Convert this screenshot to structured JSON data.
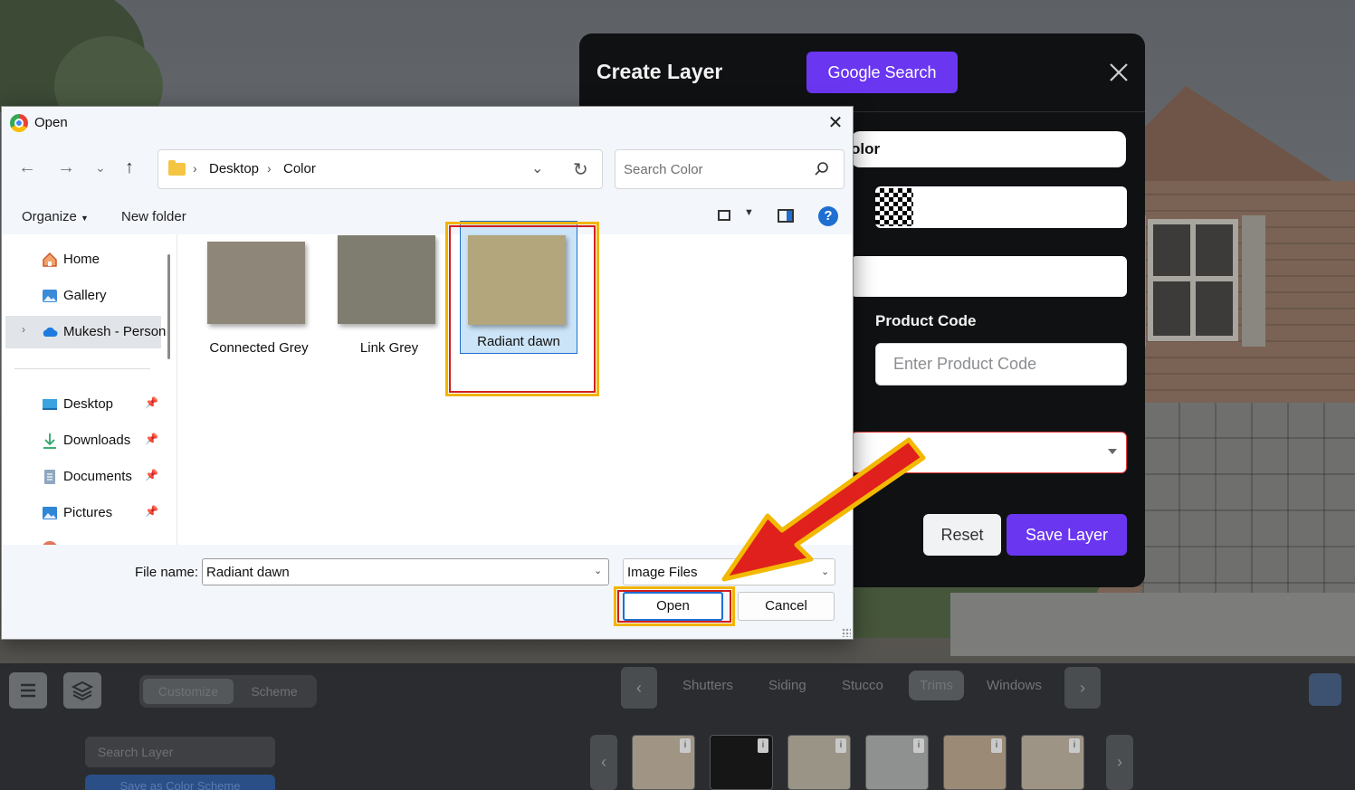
{
  "background_app": {
    "toolbar": {
      "mode_tabs": [
        "Customize",
        "Scheme"
      ],
      "categories": [
        "Shutters",
        "Siding",
        "Stucco",
        "Trims",
        "Windows"
      ],
      "active_category": "Trims",
      "search_layer_placeholder": "Search Layer",
      "save_scheme_label": "Save as Color Scheme",
      "swatches": [
        {
          "color": "#a09585"
        },
        {
          "color": "#161616"
        },
        {
          "color": "#9a9487"
        },
        {
          "color": "#8f9190"
        },
        {
          "color": "#9a8a76"
        },
        {
          "color": "#9e9486"
        }
      ]
    }
  },
  "modal": {
    "title": "Create Layer",
    "google_search_label": "Google Search",
    "name_field_value": "olor",
    "product_code_label": "Product Code",
    "product_code_placeholder": "Enter Product Code",
    "reset_label": "Reset",
    "save_label": "Save Layer",
    "accent_color": "#6a36f0"
  },
  "dialog": {
    "title": "Open",
    "breadcrumb": [
      "Desktop",
      "Color"
    ],
    "search_placeholder": "Search Color",
    "organize_label": "Organize",
    "new_folder_label": "New folder",
    "sidebar": {
      "top_items": [
        {
          "label": "Home",
          "icon": "home-icon"
        },
        {
          "label": "Gallery",
          "icon": "gallery-icon"
        },
        {
          "label": "Mukesh - Person",
          "icon": "onedrive-cloud-icon"
        }
      ],
      "quick_access": [
        {
          "label": "Desktop",
          "icon": "desktop-icon"
        },
        {
          "label": "Downloads",
          "icon": "downloads-icon"
        },
        {
          "label": "Documents",
          "icon": "documents-icon"
        },
        {
          "label": "Pictures",
          "icon": "pictures-icon"
        }
      ]
    },
    "files": [
      {
        "name": "Connected Grey",
        "color": "#8e8678",
        "selected": false
      },
      {
        "name": "Link Grey",
        "color": "#7e7d70",
        "selected": false
      },
      {
        "name": "Radiant dawn",
        "color": "#b3a57c",
        "selected": true
      }
    ],
    "file_name_label": "File name:",
    "file_name_value": "Radiant dawn",
    "file_type_value": "Image Files",
    "open_label": "Open",
    "cancel_label": "Cancel"
  }
}
